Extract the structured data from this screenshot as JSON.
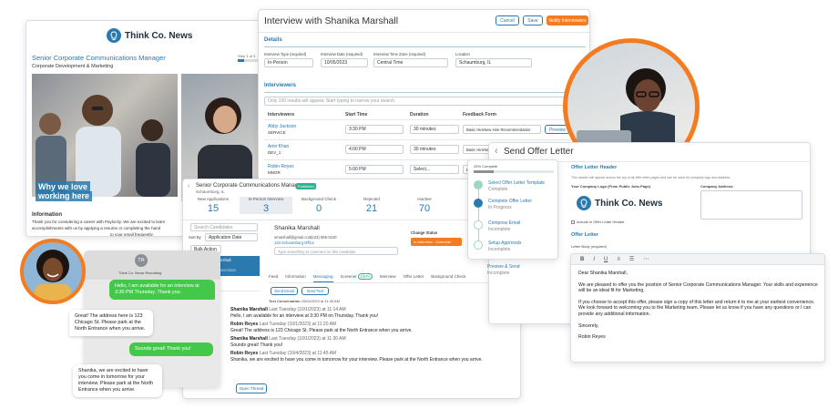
{
  "job_page": {
    "brand": "Think Co. News",
    "title": "Senior Corporate Communications Manager",
    "department": "Corporate Development & Marketing",
    "step": "Step 1 of 3",
    "banner_line1": "Why we love",
    "banner_line2": "working here",
    "info_heading": "Information",
    "info_text1": "Thank you for considering a career with Paylocity. We are excited to learn",
    "info_text2": "accomplishments with us by applying a resume or completing the hand",
    "info_text3": "to your email frequently.",
    "info_text4": "n by creating a profile and submitting your",
    "info_text5": "ersonal information: direct identifiers, inst"
  },
  "interview": {
    "title": "Interview with Shanika Marshall",
    "cancel": "Cancel",
    "save": "Save",
    "notify": "Notify Interviewers",
    "details": "Details",
    "type_label": "Interview Type (required)",
    "type_value": "In-Person",
    "date_label": "Interview Date (required)",
    "date_value": "10/05/2023",
    "tz_label": "Interview Time Zone (required)",
    "tz_value": "Central Time",
    "loc_label": "Location",
    "loc_value": "Schaumburg, IL",
    "interviewers": "Interviewers",
    "search_placeholder": "Only 100 results will appear. Start typing to narrow your search.",
    "col_interviewer": "Interviewers",
    "col_start": "Start Time",
    "col_duration": "Duration",
    "col_feedback": "Feedback Form",
    "rows": [
      {
        "name": "Abby Jackson",
        "dept": "SERVICE",
        "time": "3:30 PM",
        "duration": "30 minutes",
        "form": "Basic HireNew Hire Recommendation"
      },
      {
        "name": "Amir Khan",
        "dept": "DEV_1",
        "time": "4:00 PM",
        "duration": "30 minutes",
        "form": "Basic HireNew Hire Recommendation"
      },
      {
        "name": "Robin Reyes",
        "dept": "MNGR",
        "time": "5:00 PM",
        "duration": "Select...",
        "form": "Basic HireNew Hire Recommendation"
      }
    ],
    "preview": "Preview"
  },
  "candidate": {
    "job_title": "Senior Corporate Communications Manager",
    "published": "Published",
    "location": "Schaumburg, IL",
    "stats": [
      {
        "label": "New Applications",
        "value": "15"
      },
      {
        "label": "In-Person Interview",
        "value": "3"
      },
      {
        "label": "Background Check",
        "value": "0"
      },
      {
        "label": "Rejected",
        "value": "21"
      },
      {
        "label": "Inactive",
        "value": "70"
      },
      {
        "label": "Offer",
        "value": "0"
      }
    ],
    "search_placeholder": "Search Candidates",
    "sort_label": "Sort By",
    "sort_value": "Application Date",
    "bulk_action": "Bulk Action",
    "list_name": "Shanika Marshall",
    "list_status": "Interview",
    "list_date": "SUBMITTED 09/27/2023",
    "list_other": "John Smith",
    "name": "Shanika Marshall",
    "email": "smarshall@gmail.com",
    "phone": "(123) 555-0100",
    "office": "123 Schaumburg Office",
    "comment_placeholder": "Type something to comment on this candidate",
    "change_status": "Change Status",
    "status_value": "In-Interview - Schedule",
    "tabs": [
      "Feed",
      "Information",
      "Messaging",
      "Screener",
      "Interview",
      "Offer Letter",
      "Background Check"
    ],
    "screener_badge": "100%",
    "send_email": "Send Email",
    "send_text": "Send Text",
    "conv_label": "Text Conversation",
    "conv_date": "10/04/2023 at 11:45 AM",
    "messages": [
      {
        "author": "Shanika Marshall",
        "time": "Last Tuesday (10/1/2023) at 11:14 AM",
        "text": "Hello, I am available for an interview at 3:30 PM on Thursday. Thank you!"
      },
      {
        "author": "Robin Reyes",
        "time": "Last Tuesday (10/1/2023) at 11:20 AM",
        "text": "Great! The address is 123 Chicago St. Please park at the North Entrance when you arrive."
      },
      {
        "author": "Shanika Marshall",
        "time": "Last Tuesday (10/1/2023) at 11:30 AM",
        "text": "Sounds great! Thank you!"
      },
      {
        "author": "Robin Reyes",
        "time": "Last Tuesday (10/4/2023) at 11:45 AM",
        "text": "Shanika, we are excited to have you come in tomorrow for your interview. Please park at the North Entrance when you arrive."
      }
    ],
    "open_thread": "Open Thread"
  },
  "chat": {
    "avatar_initials": "TR",
    "sender": "Think Co. News Recruiting",
    "bubbles": [
      {
        "side": "right",
        "text": "Hello, I am available for an interview at 3:30 PM Thursday. Thank you."
      },
      {
        "side": "left",
        "text": "Great! The address here is 123 Chicago St. Please park at the North Entrance when you arrive."
      },
      {
        "side": "right",
        "text": "Sounds great! Thank you!"
      },
      {
        "side": "left",
        "text": "Shanika, we are excited to have you come in tomorrow for your interview. Please park at the North Entrance when you arrive."
      }
    ]
  },
  "offer": {
    "title": "Send Offer Letter",
    "progress_label": "25% Complete",
    "progress": 0.25,
    "steps": [
      {
        "label": "Select Offer Letter Template",
        "status": "Complete"
      },
      {
        "label": "Complete Offer Letter",
        "status": "In Progress"
      },
      {
        "label": "Compose Email",
        "status": "Incomplete"
      },
      {
        "label": "Setup Approvals",
        "status": "Incomplete"
      },
      {
        "label": "Preview & Send",
        "status": "Incomplete"
      }
    ],
    "header_section": "Offer Letter Header",
    "header_note": "This header will appear across the top of all offer letter pages and can be used for company logo and address.",
    "logo_label": "Your Company Logo (From Public Jobs Page)",
    "address_label": "Company Address:",
    "brand": "Think Co. News",
    "include_label": "Include in Offer Letter Header",
    "letter_section": "Offer Letter",
    "body_label": "Letter Body (required)"
  },
  "letter": {
    "greeting": "Dear Shanika Marshall,",
    "p1": "We are pleased to offer you the position of Senior Corporate Communications Manager. Your skills and experience will be an ideal fit for Marketing.",
    "p2": "If you choose to accept this offer, please sign a copy of this letter and return it to me at your earliest convenience.  We look forward to welcoming you to the Marketing team. Please let us know if you have any questions or I can provide any additional information.",
    "closing": "Sincerely,",
    "signature": "Robin Reyes"
  },
  "colors": {
    "brand_blue": "#2a7ab0",
    "orange": "#f47b20",
    "green": "#43c84a",
    "teal": "#2fb08f"
  }
}
